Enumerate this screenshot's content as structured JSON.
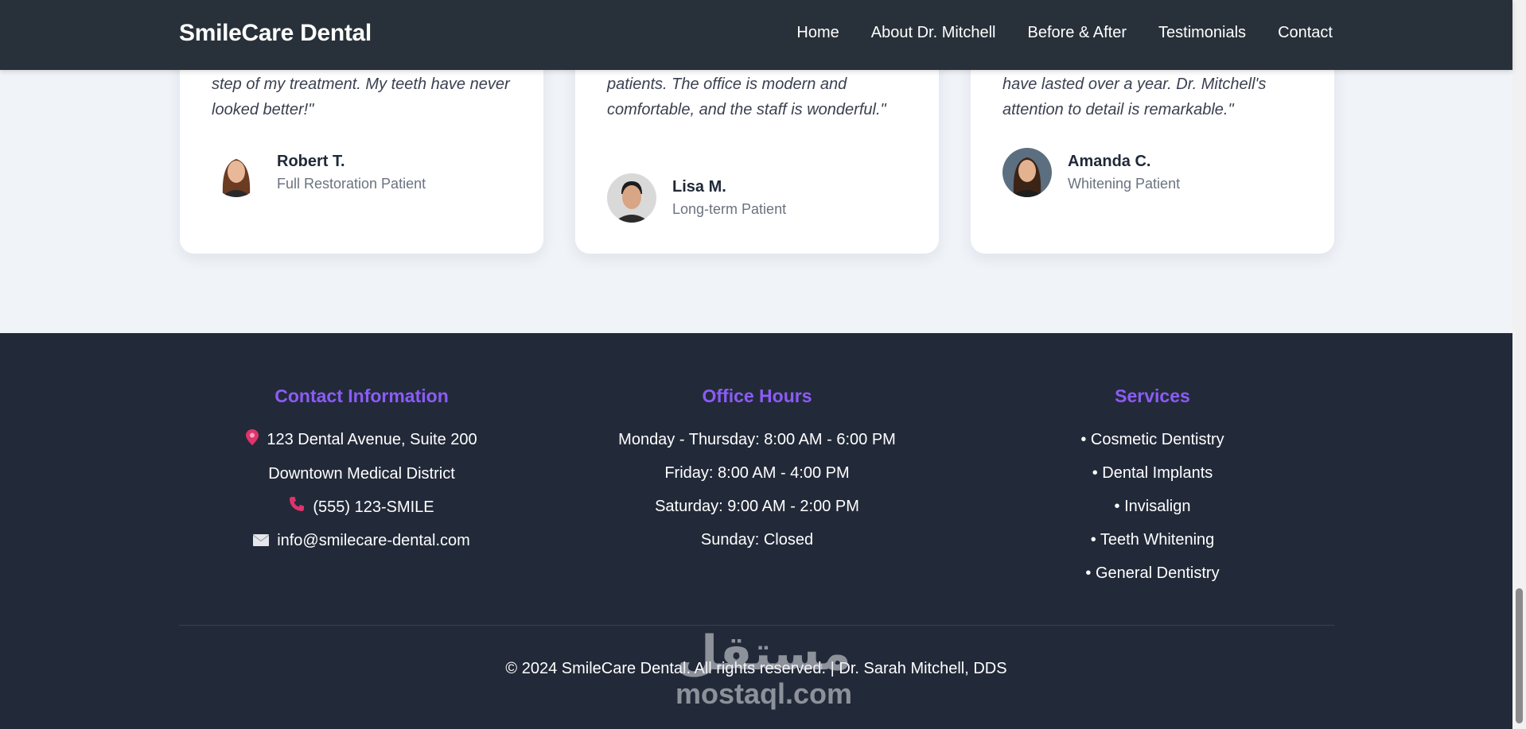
{
  "nav": {
    "brand": "SmileCare Dental",
    "links": [
      "Home",
      "About Dr. Mitchell",
      "Before & After",
      "Testimonials",
      "Contact"
    ]
  },
  "testimonials": [
    {
      "quote": "step of my treatment. My teeth have never looked better!\"",
      "name": "Robert T.",
      "role": "Full Restoration Patient"
    },
    {
      "quote": "patients. The office is modern and comfortable, and the staff is wonderful.\"",
      "name": "Lisa M.",
      "role": "Long-term Patient"
    },
    {
      "quote": "have lasted over a year. Dr. Mitchell's attention to detail is remarkable.\"",
      "name": "Amanda C.",
      "role": "Whitening Patient"
    }
  ],
  "footer": {
    "contact": {
      "title": "Contact Information",
      "address1": "123 Dental Avenue, Suite 200",
      "address2": "Downtown Medical District",
      "phone": "(555) 123-SMILE",
      "email": "info@smilecare-dental.com"
    },
    "hours": {
      "title": "Office Hours",
      "lines": [
        "Monday - Thursday: 8:00 AM - 6:00 PM",
        "Friday: 8:00 AM - 4:00 PM",
        "Saturday: 9:00 AM - 2:00 PM",
        "Sunday: Closed"
      ]
    },
    "services": {
      "title": "Services",
      "items": [
        "• Cosmetic Dentistry",
        "• Dental Implants",
        "• Invisalign",
        "• Teeth Whitening",
        "• General Dentistry"
      ]
    },
    "copyright": "© 2024 SmileCare Dental. All rights reserved. | Dr. Sarah Mitchell, DDS"
  },
  "watermark": {
    "arabic": "مستقل",
    "latin": "mostaql.com"
  },
  "colors": {
    "accent": "#8b5cf6",
    "nav_bg": "#283139",
    "footer_bg": "#222a39",
    "icon_pink": "#e0336b"
  },
  "icons": [
    "pin-icon",
    "phone-icon",
    "envelope-icon"
  ]
}
